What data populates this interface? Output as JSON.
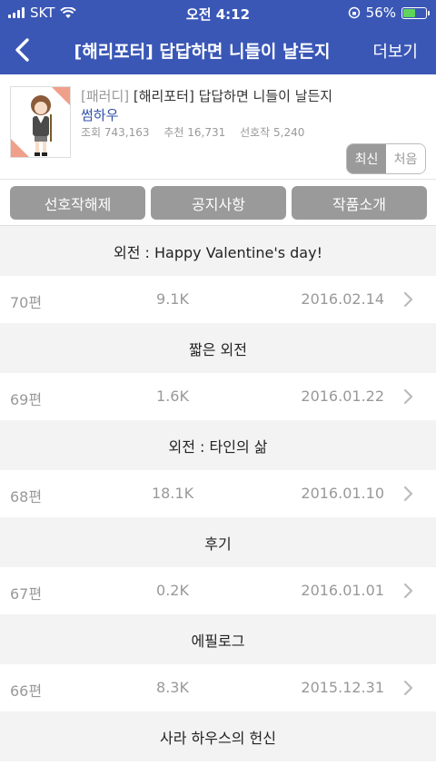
{
  "status_bar": {
    "carrier": "SKT",
    "time": "오전 4:12",
    "battery_percent": "56%",
    "battery_level": 0.56
  },
  "nav": {
    "title": "[해리포터] 답답하면 니들이 날든지",
    "more_label": "더보기"
  },
  "book": {
    "tag": "[패러디]",
    "title": "[해리포터] 답답하면 니들이 날든지",
    "author": "썸하우",
    "views": "조회 743,163",
    "recommend": "추천 16,731",
    "favorites": "선호작 5,240"
  },
  "sort": {
    "latest": "최신",
    "first": "처음"
  },
  "actions": {
    "unfavorite": "선호작해제",
    "notice": "공지사항",
    "intro": "작품소개"
  },
  "chapters": [
    {
      "title": "외전 : Happy Valentine's day!",
      "num": "70편",
      "views": "9.1K",
      "date": "2016.02.14"
    },
    {
      "title": "짧은 외전",
      "num": "69편",
      "views": "1.6K",
      "date": "2016.01.22"
    },
    {
      "title": "외전 : 타인의 삶",
      "num": "68편",
      "views": "18.1K",
      "date": "2016.01.10"
    },
    {
      "title": "후기",
      "num": "67편",
      "views": "0.2K",
      "date": "2016.01.01"
    },
    {
      "title": "에필로그",
      "num": "66편",
      "views": "8.3K",
      "date": "2015.12.31"
    },
    {
      "title": "사라 하우스의 헌신"
    }
  ],
  "colors": {
    "header": "#3a57b6",
    "author": "#2f4fa8",
    "button": "#9a9a9a"
  }
}
